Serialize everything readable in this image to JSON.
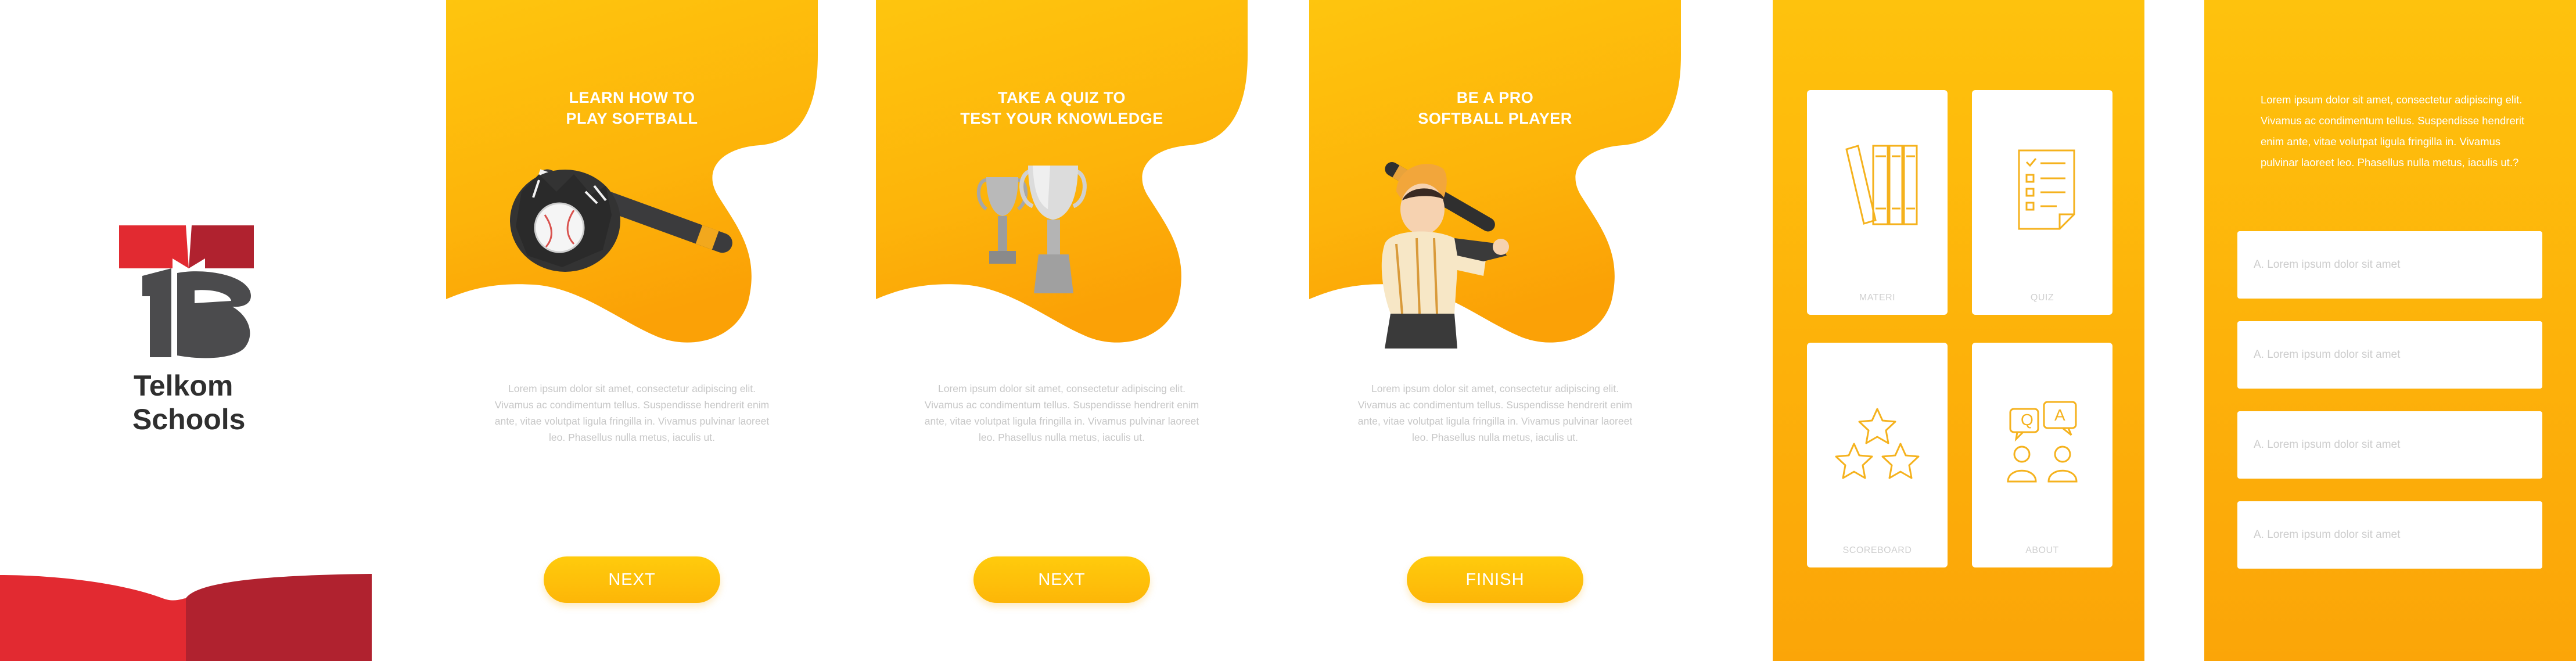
{
  "brand": {
    "name_line1": "Telkom",
    "name_line2": "Schools",
    "colors": {
      "red": "#e22a31",
      "dark_red": "#b02030",
      "grey": "#4b4b4d"
    }
  },
  "onboarding": [
    {
      "title_line1": "LEARN HOW TO",
      "title_line2": "PLAY SOFTBALL",
      "body": "Lorem ipsum dolor sit amet, consectetur adipiscing elit. Vivamus ac condimentum tellus. Suspendisse hendrerit enim ante, vitae volutpat ligula fringilla in. Vivamus pulvinar laoreet leo. Phasellus nulla metus, iaculis ut.",
      "button": "NEXT",
      "illustration": "glove-and-bat"
    },
    {
      "title_line1": "TAKE A QUIZ TO",
      "title_line2": "TEST YOUR KNOWLEDGE",
      "body": "Lorem ipsum dolor sit amet, consectetur adipiscing elit. Vivamus ac condimentum tellus. Suspendisse hendrerit enim ante, vitae volutpat ligula fringilla in. Vivamus pulvinar laoreet leo. Phasellus nulla metus, iaculis ut.",
      "button": "NEXT",
      "illustration": "trophies"
    },
    {
      "title_line1": "BE A PRO",
      "title_line2": "SOFTBALL PLAYER",
      "body": "Lorem ipsum dolor sit amet, consectetur adipiscing elit. Vivamus ac condimentum tellus. Suspendisse hendrerit enim ante, vitae volutpat ligula fringilla in. Vivamus pulvinar laoreet leo. Phasellus nulla metus, iaculis ut.",
      "button": "FINISH",
      "illustration": "softball-player"
    }
  ],
  "menu": {
    "items": [
      {
        "label": "MATERI",
        "icon": "books-icon"
      },
      {
        "label": "QUIZ",
        "icon": "checklist-icon"
      },
      {
        "label": "SCOREBOARD",
        "icon": "stars-icon"
      },
      {
        "label": "ABOUT",
        "icon": "chat-people-icon"
      }
    ]
  },
  "quiz": {
    "question": "Lorem ipsum dolor sit amet, consectetur adipiscing elit. Vivamus ac condimentum tellus. Suspendisse hendrerit enim ante, vitae volutpat ligula fringilla in. Vivamus pulvinar laoreet leo. Phasellus nulla metus, iaculis ut.?",
    "answers": [
      "A. Lorem ipsum dolor sit amet",
      "A. Lorem ipsum dolor sit amet",
      "A. Lorem ipsum dolor sit amet",
      "A. Lorem ipsum dolor sit amet"
    ]
  },
  "colors": {
    "accent": "#fdb608",
    "accent_light": "#fec20d",
    "accent_dark": "#fba508",
    "card_label": "#cfcfcf",
    "body_text": "#c7c7c7"
  }
}
